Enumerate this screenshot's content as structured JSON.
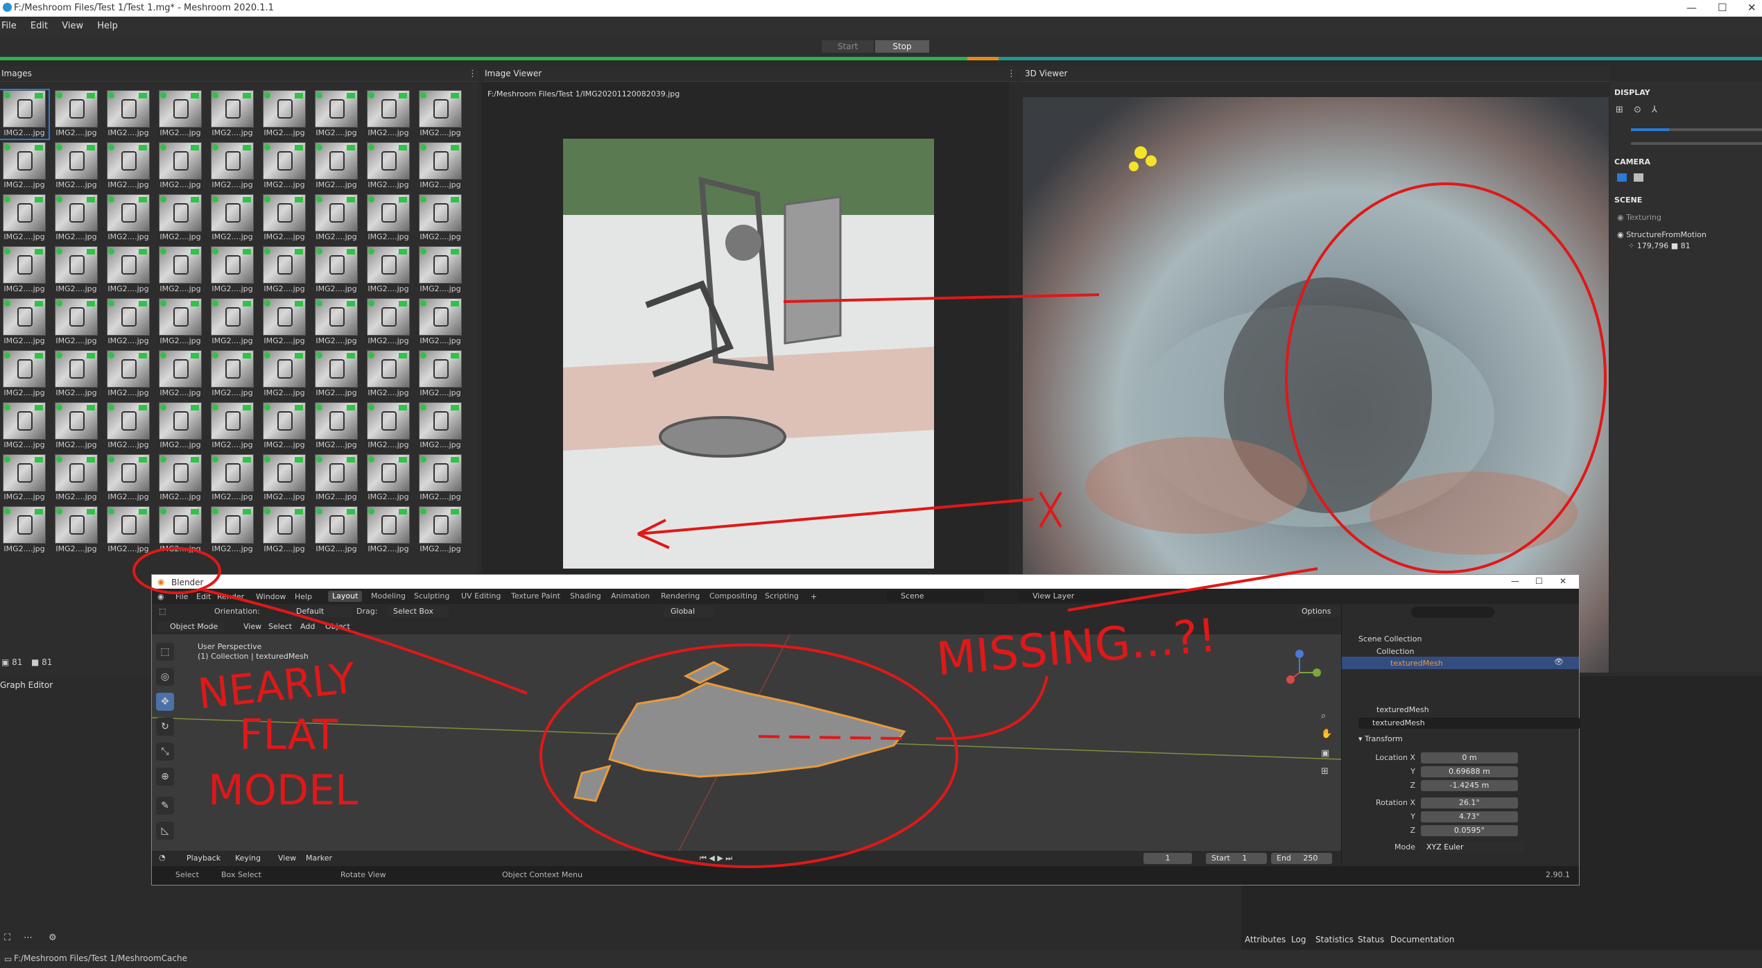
{
  "window": {
    "title": "F:/Meshroom Files/Test 1/Test 1.mg* - Meshroom 2020.1.1"
  },
  "menu": [
    "File",
    "Edit",
    "View",
    "Help"
  ],
  "run": {
    "start": "Start",
    "stop": "Stop"
  },
  "images_panel": {
    "title": "Images",
    "thumb_label": "IMG2....jpg",
    "selected_label": "IMG2....jpg",
    "count_images": "81",
    "count_cams": "81"
  },
  "image_viewer": {
    "title": "Image Viewer",
    "path": "F:/Meshroom Files/Test 1/IMG20201120082039.jpg"
  },
  "viewer3d": {
    "title": "3D Viewer"
  },
  "display_panel": {
    "display": "DISPLAY",
    "camera": "CAMERA",
    "scene": "SCENE",
    "texturing": "Texturing",
    "sfm": "StructureFromMotion",
    "sfm_points": "179,796",
    "sfm_cams": "81"
  },
  "graph_editor": {
    "title": "Graph Editor"
  },
  "bottom_tabs": [
    "Attributes",
    "Log",
    "Statistics",
    "Status",
    "Documentation"
  ],
  "footer_path": "F:/Meshroom Files/Test 1/MeshroomCache",
  "blender": {
    "title": "Blender",
    "menu": [
      "File",
      "Edit",
      "Render",
      "Window",
      "Help"
    ],
    "workspaces": [
      "Layout",
      "Modeling",
      "Sculpting",
      "UV Editing",
      "Texture Paint",
      "Shading",
      "Animation",
      "Rendering",
      "Compositing",
      "Scripting"
    ],
    "scene": "Scene",
    "view_layer": "View Layer",
    "orientation_label": "Orientation:",
    "orientation_value": "Default",
    "drag_label": "Drag:",
    "drag_value": "Select Box",
    "transform_global": "Global",
    "options": "Options",
    "mode": "Object Mode",
    "vp_menu": [
      "View",
      "Select",
      "Add",
      "Object"
    ],
    "vp_info1": "User Perspective",
    "vp_info2": "(1) Collection | texturedMesh",
    "timeline": {
      "playback": "Playback",
      "keying": "Keying",
      "view": "View",
      "marker": "Marker",
      "frame": "1",
      "start_label": "Start",
      "start": "1",
      "end_label": "End",
      "end": "250"
    },
    "status": {
      "select": "Select",
      "box_select": "Box Select",
      "rotate": "Rotate View",
      "context": "Object Context Menu",
      "version": "2.90.1"
    },
    "outliner": {
      "scene_collection": "Scene Collection",
      "collection": "Collection",
      "mesh": "texturedMesh"
    },
    "props": {
      "object_name": "texturedMesh",
      "data_name": "texturedMesh",
      "transform": "Transform",
      "location_x_label": "Location X",
      "location_x": "0 m",
      "location_y_label": "Y",
      "location_y": "0.69688 m",
      "location_z_label": "Z",
      "location_z": "-1.4245 m",
      "rotation_x_label": "Rotation X",
      "rotation_x": "26.1°",
      "rotation_y_label": "Y",
      "rotation_y": "4.73°",
      "rotation_z_label": "Z",
      "rotation_z": "0.0595°",
      "mode_label": "Mode",
      "mode": "XYZ Euler"
    }
  },
  "annotations": {
    "nearly": "NEARLY",
    "flat": "FLAT",
    "model": "MODEL",
    "missing": "MISSING...?!"
  },
  "colors": {
    "accent": "#2a7ad6",
    "progress": "#1ea870",
    "annotation": "#e01818",
    "selection": "#e89a3c"
  }
}
